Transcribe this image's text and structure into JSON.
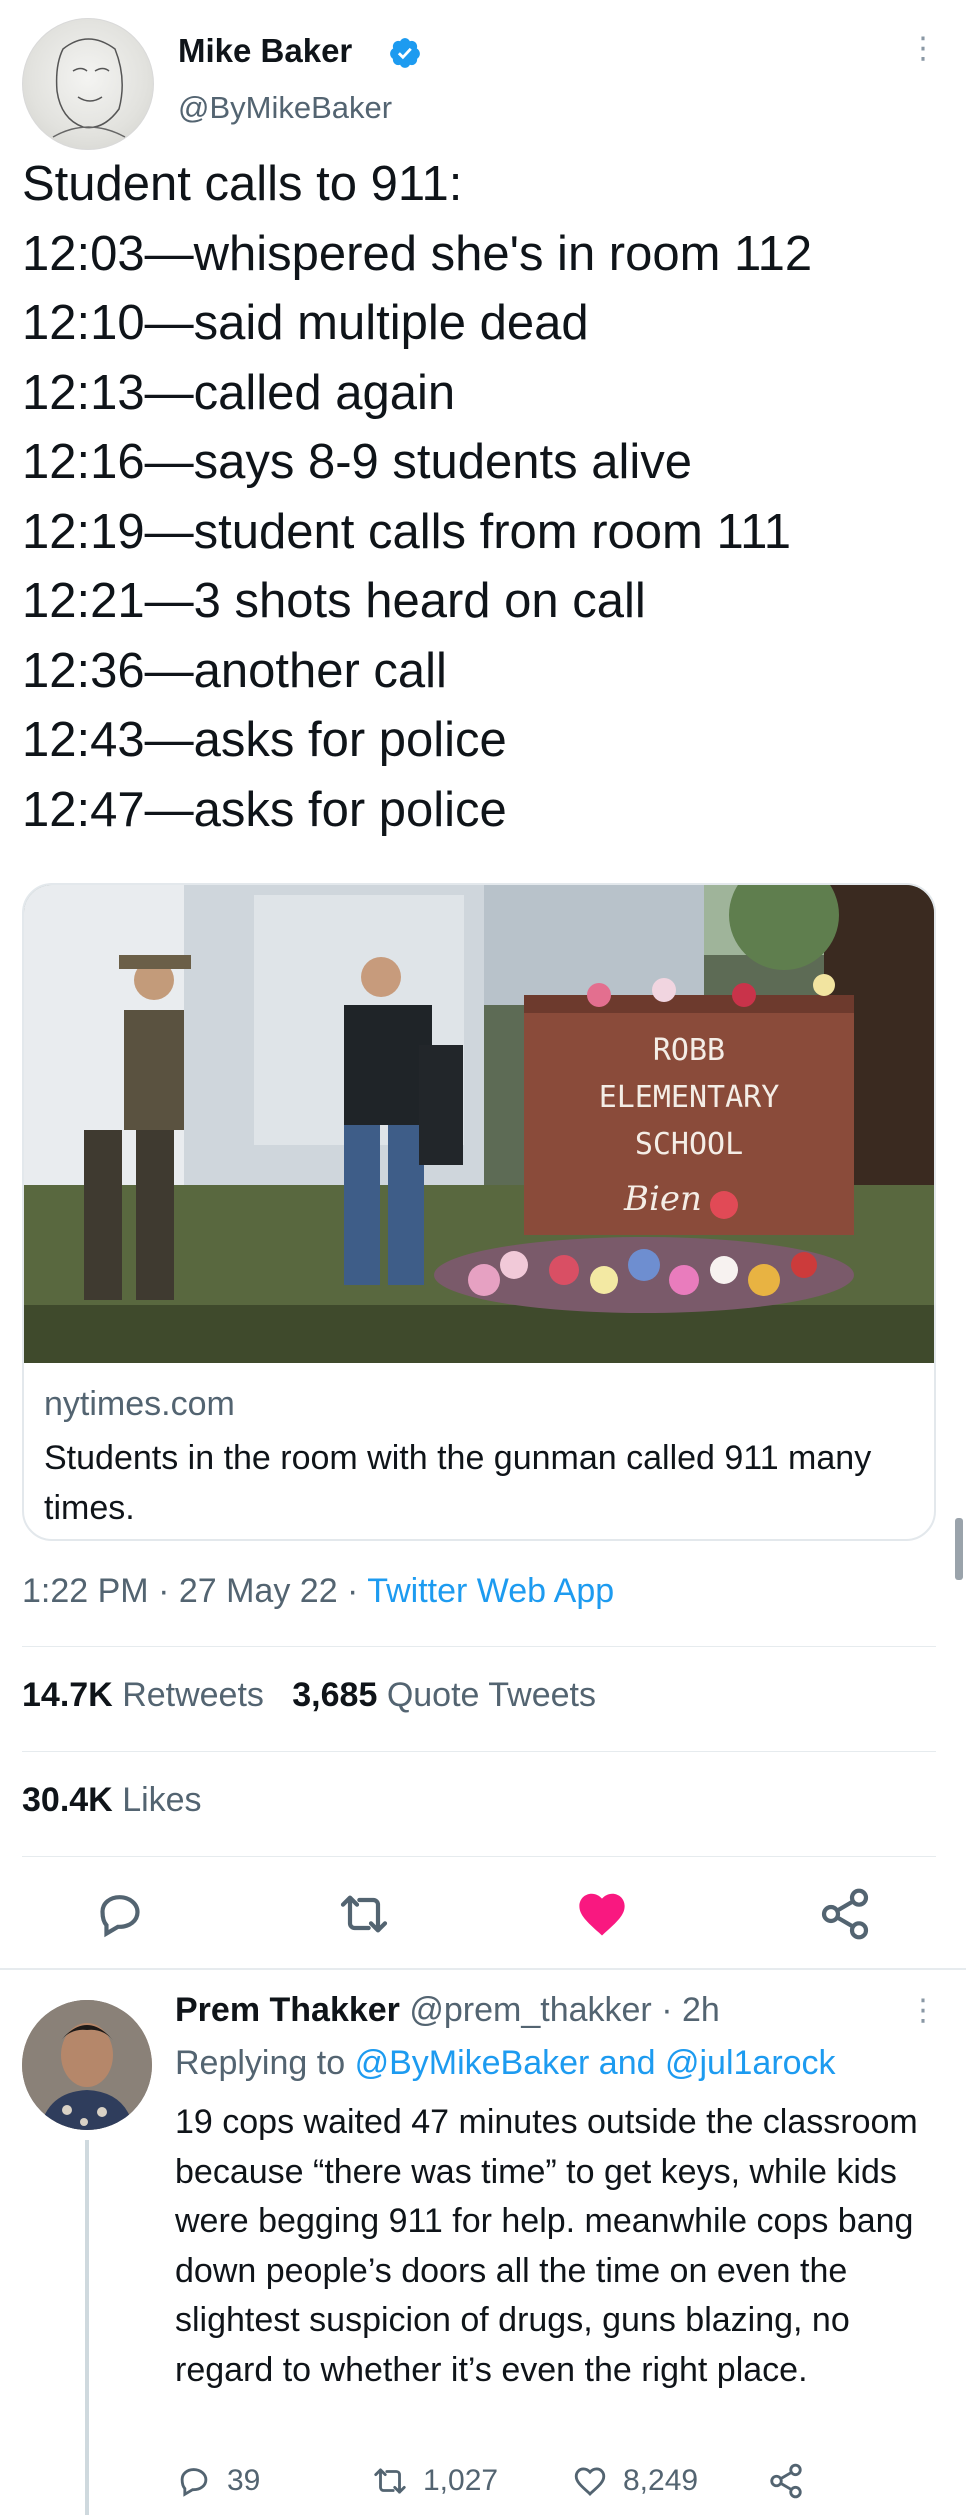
{
  "main_tweet": {
    "author": {
      "name": "Mike Baker",
      "handle": "@ByMikeBaker",
      "verified": true
    },
    "lines": [
      "Student calls to 911:",
      "12:03—whispered she's in room 112",
      "12:10—said multiple dead",
      "12:13—called again",
      "12:16—says 8-9 students alive",
      "12:19—student calls from room 111",
      "12:21—3 shots heard on call",
      "12:36—another call",
      "12:43—asks for police",
      "12:47—asks for police"
    ],
    "card": {
      "domain": "nytimes.com",
      "title": "Students in the room with the gunman called 911 many times.",
      "sign_lines": [
        "ROBB",
        "ELEMENTARY",
        "SCHOOL"
      ],
      "sign_script": "Bien"
    },
    "time": "1:22 PM",
    "date": "27 May 22",
    "source": "Twitter Web App",
    "separator": " · ",
    "stats": {
      "retweets": "14.7K",
      "retweets_label": "Retweets",
      "quotes": "3,685",
      "quotes_label": "Quote Tweets",
      "likes": "30.4K",
      "likes_label": "Likes"
    },
    "actions": [
      "reply-icon",
      "retweet-icon",
      "like-icon-filled",
      "share-icon"
    ]
  },
  "reply": {
    "name": "Prem Thakker",
    "handle": "@prem_thakker",
    "time": "2h",
    "replying_prefix": "Replying to",
    "replying_to": "@ByMikeBaker and @jul1arock",
    "text": "19 cops waited 47 minutes outside the classroom because “there was time” to get keys, while kids were begging 911 for help. meanwhile cops bang down people’s doors all the time on even the slightest suspicion of drugs, guns blazing, no regard to whether it’s even the right place.",
    "counts": {
      "replies": "39",
      "retweets": "1,027",
      "likes": "8,249"
    }
  },
  "colors": {
    "accent": "#1d9bf0",
    "like": "#f91880",
    "text": "#0f1419",
    "muted": "#536471"
  }
}
